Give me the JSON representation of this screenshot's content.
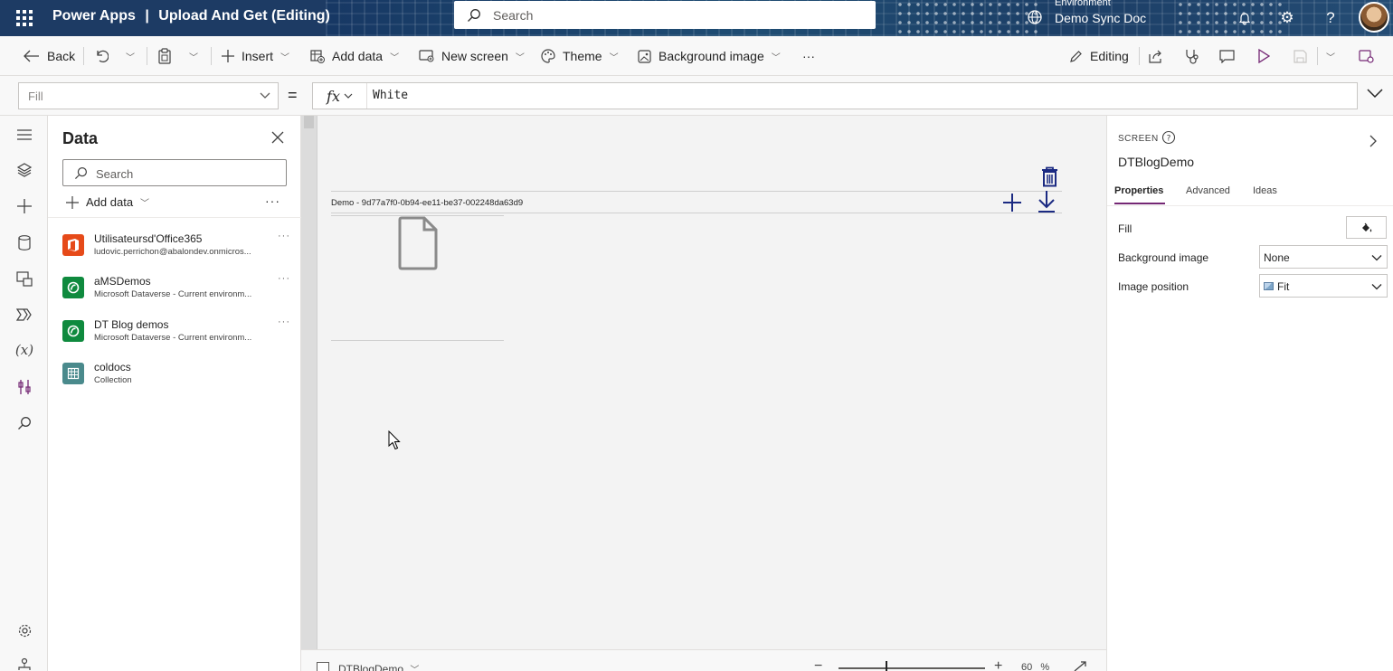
{
  "header": {
    "app_name": "Power Apps",
    "separator": "|",
    "app_title": "Upload And Get (Editing)",
    "search_placeholder": "Search",
    "environment_label": "Environment",
    "environment_name": "Demo Sync Doc"
  },
  "toolbar": {
    "back": "Back",
    "insert": "Insert",
    "add_data": "Add data",
    "new_screen": "New screen",
    "theme": "Theme",
    "background_image": "Background image",
    "more": "···",
    "editing": "Editing"
  },
  "formula": {
    "property": "Fill",
    "equals": "=",
    "fx": "fx",
    "value": "White"
  },
  "data_panel": {
    "title": "Data",
    "search_placeholder": "Search",
    "add_data": "Add data",
    "more": "···",
    "sources": [
      {
        "name": "Utilisateursd'Office365",
        "subtitle": "ludovic.perrichon@abalondev.onmicros...",
        "icon": "office365-icon",
        "color": "#e64a19"
      },
      {
        "name": "aMSDemos",
        "subtitle": "Microsoft Dataverse - Current environm...",
        "icon": "dataverse-icon",
        "color": "#0f8a3e"
      },
      {
        "name": "DT Blog demos",
        "subtitle": "Microsoft Dataverse - Current environm...",
        "icon": "dataverse-icon",
        "color": "#0f8a3e"
      },
      {
        "name": "coldocs",
        "subtitle": "Collection",
        "icon": "collection-icon",
        "color": "#4a8a8c"
      }
    ]
  },
  "canvas": {
    "demo_label": "Demo - 9d77a7f0-0b94-ee11-be37-002248da63d9",
    "icon_color": "#1b2a82"
  },
  "bottom": {
    "screen_name": "DTBlogDemo",
    "zoom_value": "60",
    "zoom_unit": "%"
  },
  "properties": {
    "kind": "SCREEN",
    "name": "DTBlogDemo",
    "tabs": [
      "Properties",
      "Advanced",
      "Ideas"
    ],
    "fill_label": "Fill",
    "background_image_label": "Background image",
    "background_image_value": "None",
    "image_position_label": "Image position",
    "image_position_value": "Fit"
  },
  "colors": {
    "header_bg": "#1d3b64",
    "accent": "#742774"
  }
}
